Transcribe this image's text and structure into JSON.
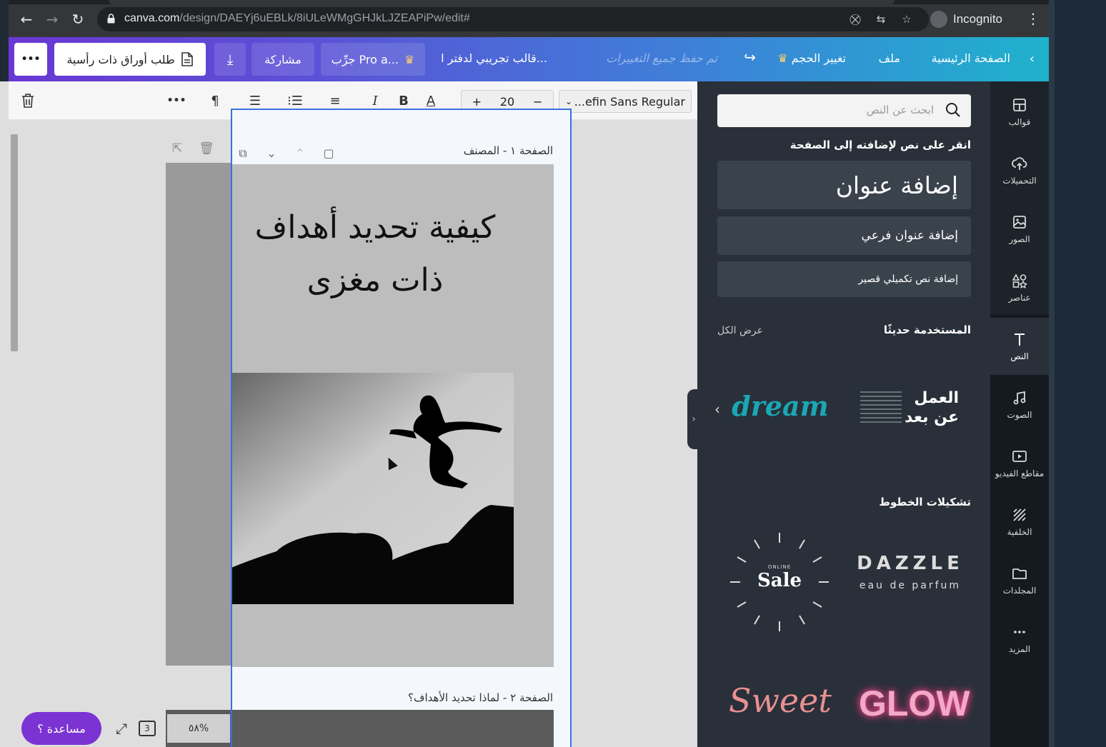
{
  "browser": {
    "url_host": "canva.com",
    "url_path": "/design/DAEYj6uEBLk/8iULeWMgGHJkLJZEAPiPw/edit#",
    "profile_label": "Incognito"
  },
  "header": {
    "home": "الصفحة الرئيسية",
    "file": "ملف",
    "resize": "تغيير الحجم",
    "saved_status": "تم حفظ جميع التغييرات",
    "design_title": "قالب تجريبي لدفتر ا...",
    "try_pro": "جرِّب Pro a...",
    "share": "مشاركة",
    "print_order": "طلب أوراق ذات رأسية",
    "more": "•••"
  },
  "toolbar": {
    "font_name": "...efin Sans Regular",
    "font_size": "20",
    "minus": "−",
    "plus": "+",
    "more": "•••"
  },
  "pages": {
    "page1_label": "الصفحة ١ - المصنف",
    "page1_title": "كيفية تحديد أهداف\nذات مغزى",
    "page2_label": "الصفحة ٢ - لماذا تحديد الأهداف؟"
  },
  "footer": {
    "help": "مساعدة ؟",
    "page_count": "3",
    "zoom": "٥٨%"
  },
  "panel": {
    "search_placeholder": "ابحث عن النص",
    "click_hint": "انقر على نص لإضافته إلى الصفحة",
    "add_heading": "إضافة عنوان",
    "add_subheading": "إضافة عنوان فرعي",
    "add_body": "إضافة نص تكميلي قصير",
    "recent_title": "المستخدمة حديثًا",
    "view_all": "عرض الكل",
    "combos_title": "تشكيلات الخطوط",
    "recent_items": {
      "remote_work_line1": "العمل",
      "remote_work_line2": "عن بعد",
      "dream": "dream"
    },
    "combos": {
      "dazzle": "DAZZLE",
      "dazzle_sub": "eau de parfum",
      "sale_top": "ONLINE",
      "sale": "Sale",
      "sweet": "Sweet",
      "glow": "GLOW"
    }
  },
  "sidebar": {
    "items": [
      {
        "label": "قوالب",
        "icon": "templates-icon"
      },
      {
        "label": "التحميلات",
        "icon": "upload-icon"
      },
      {
        "label": "الصور",
        "icon": "photos-icon"
      },
      {
        "label": "عناصر",
        "icon": "elements-icon"
      },
      {
        "label": "النص",
        "icon": "text-icon"
      },
      {
        "label": "الصوت",
        "icon": "audio-icon"
      },
      {
        "label": "مقاطع الفيديو",
        "icon": "video-icon"
      },
      {
        "label": "الخلفية",
        "icon": "background-icon"
      },
      {
        "label": "المجلدات",
        "icon": "folder-icon"
      },
      {
        "label": "المزيد",
        "icon": "more-icon"
      }
    ],
    "active": "النص"
  },
  "colors": {
    "accent_purple": "#7b33d3",
    "selection_blue": "#3b6ee0",
    "panel_dark": "#293039"
  }
}
